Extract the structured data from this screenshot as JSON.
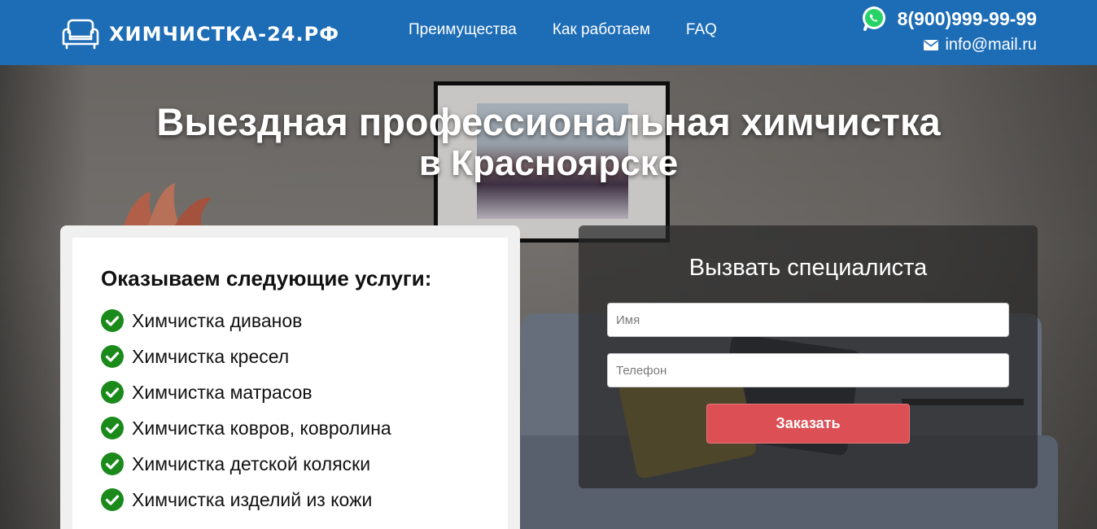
{
  "header": {
    "logo_text": "ХИМЧИСТКА-24.РФ",
    "logo_icon": "sofa-icon",
    "nav": [
      {
        "label": "Преимущества"
      },
      {
        "label": "Как работаем"
      },
      {
        "label": "FAQ"
      }
    ],
    "phone": "8(900)999-99-99",
    "phone_icon": "whatsapp-icon",
    "email": "info@mail.ru",
    "email_icon": "envelope-icon",
    "bg_color": "#1c6cb6"
  },
  "hero": {
    "title_line1": "Выездная профессиональная химчистка",
    "title_line2": "в Красноярске"
  },
  "services": {
    "title": "Оказываем следующие услуги:",
    "check_color": "#1a8a1a",
    "items": [
      {
        "label": "Химчистка диванов"
      },
      {
        "label": "Химчистка кресел"
      },
      {
        "label": "Химчистка матрасов"
      },
      {
        "label": "Химчистка ковров, ковролина"
      },
      {
        "label": "Химчистка детской коляски"
      },
      {
        "label": "Химчистка изделий из кожи"
      }
    ]
  },
  "order_form": {
    "title": "Вызвать специалиста",
    "name_placeholder": "Имя",
    "phone_placeholder": "Телефон",
    "submit_label": "Заказать",
    "submit_color": "#db4f55"
  }
}
